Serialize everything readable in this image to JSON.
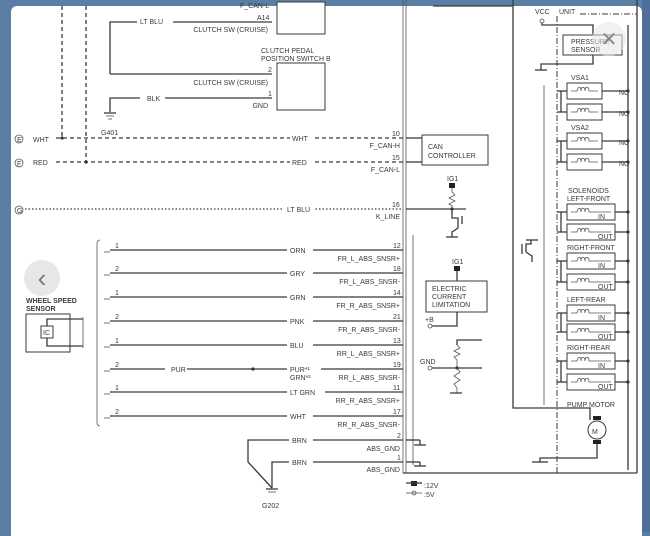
{
  "viewer": {
    "prev_icon": "chevron-left-icon",
    "close_icon": "close-icon",
    "prev_glyph": "‹",
    "close_glyph": "✕"
  },
  "diagram": {
    "clutch": {
      "top_wire_color": "LT BLU",
      "top_pin": "A14",
      "top_signal": "CLUTCH SW (CRUISE)",
      "top_cut_label": "F_CAN-L",
      "switch_title_1": "CLUTCH PEDAL",
      "switch_title_2": "POSITION SWITCH B",
      "pin2": "2",
      "pin2_signal": "CLUTCH SW (CRUISE)",
      "pin1": "1",
      "pin1_signal": "GND",
      "gnd_wire": "BLK",
      "ground": "G401"
    },
    "can": [
      {
        "connector": "E",
        "left_color": "WHT",
        "color": "WHT",
        "pin": "10",
        "signal": "F_CAN-H"
      },
      {
        "connector": "F",
        "left_color": "RED",
        "color": "RED",
        "pin": "15",
        "signal": "F_CAN-L"
      }
    ],
    "kline": {
      "connector": "G",
      "color": "LT BLU",
      "pin": "16",
      "signal": "K_LINE"
    },
    "can_controller": [
      "CAN",
      "CONTROLLER"
    ],
    "ig1_a": "IG1",
    "ig1_b": "IG1",
    "ecl": [
      "ELECTRIC",
      "CURRENT",
      "LIMITATION"
    ],
    "plus_b": "+B",
    "gnd": "GND",
    "wheel_speed_sensor": [
      "WHEEL SPEED",
      "SENSOR"
    ],
    "ic": "IC",
    "sensor_rows": [
      {
        "pin": "1",
        "color": "ORN",
        "terminal": "12",
        "signal": "FR_L_ABS_SNSR+"
      },
      {
        "pin": "2",
        "color": "GRY",
        "terminal": "18",
        "signal": "FR_L_ABS_SNSR-"
      },
      {
        "pin": "1",
        "color": "GRN",
        "terminal": "14",
        "signal": "FR_R_ABS_SNSR+"
      },
      {
        "pin": "2",
        "color": "PNK",
        "terminal": "21",
        "signal": "FR_R_ABS_SNSR-"
      },
      {
        "pin": "1",
        "color": "BLU",
        "terminal": "13",
        "signal": "RR_L_ABS_SNSR+"
      },
      {
        "pin": "2",
        "color": "PUR*¹",
        "color2": "GRN*²",
        "left_color": "PUR",
        "terminal": "19",
        "signal": "RR_L_ABS_SNSR-"
      },
      {
        "pin": "1",
        "color": "LT GRN",
        "terminal": "11",
        "signal": "RR_R_ABS_SNSR+"
      },
      {
        "pin": "2",
        "color": "WHT",
        "terminal": "17",
        "signal": "RR_R_ABS_SNSR-"
      }
    ],
    "grounds": [
      {
        "color": "BRN",
        "terminal": "2",
        "signal": "ABS_GND"
      },
      {
        "color": "BRN",
        "terminal": "1",
        "signal": "ABS_GND"
      }
    ],
    "g202": "G202",
    "unit": {
      "vcc": "VCC",
      "label": "UNIT",
      "pressure_sensor": [
        "PRESSURE",
        "SENSOR"
      ]
    },
    "solenoid_groups": [
      {
        "title": "VSA1",
        "a": "NC",
        "b": "NO"
      },
      {
        "title": "VSA2",
        "a": "NC",
        "b": "NO"
      },
      {
        "title": "LEFT-FRONT",
        "title_pre": "SOLENOIDS",
        "a": "IN",
        "b": "OUT"
      },
      {
        "title": "RIGHT-FRONT",
        "a": "IN",
        "b": "OUT"
      },
      {
        "title": "LEFT-REAR",
        "a": "IN",
        "b": "OUT"
      },
      {
        "title": "RIGHT-REAR",
        "a": "IN",
        "b": "OUT"
      }
    ],
    "pump_motor": "PUMP MOTOR",
    "motor_symbol": "M",
    "legend": [
      ":12V",
      ":5V"
    ]
  }
}
